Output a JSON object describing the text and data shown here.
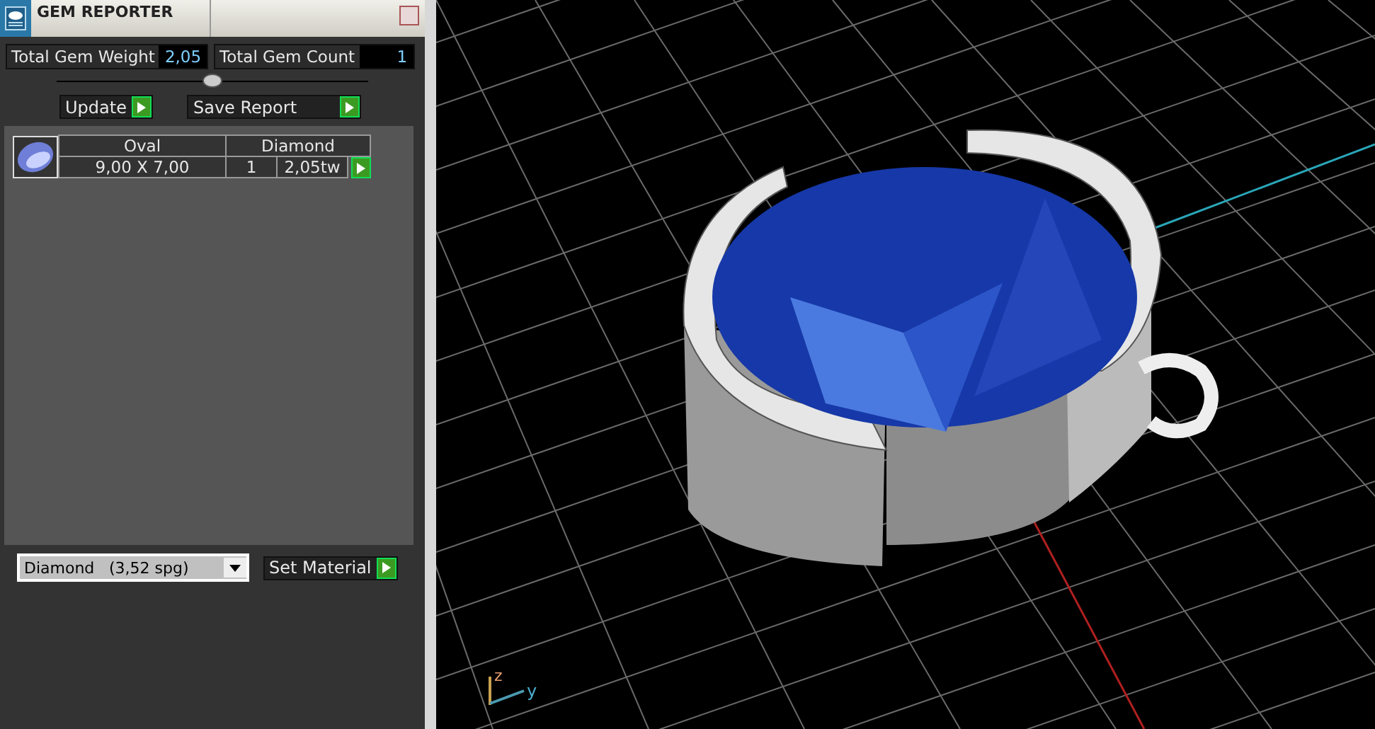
{
  "panel": {
    "title": "GEM REPORTER"
  },
  "totals": [
    {
      "label": "Total Gem Weight",
      "value": "2,05"
    },
    {
      "label": "Total Gem Count",
      "value": "1"
    }
  ],
  "buttons": [
    {
      "label": "Update"
    },
    {
      "label": "Save Report"
    }
  ],
  "gems": [
    {
      "shape": "Oval",
      "material": "Diamond",
      "size": "9,00 X 7,00",
      "count": "1",
      "weight": "2,05tw"
    }
  ],
  "material_select": {
    "name": "Diamond",
    "density": "(3,52 spg)"
  },
  "set_material": {
    "label": "Set Material"
  },
  "viewport": {
    "axes": [
      {
        "label": "z"
      },
      {
        "label": "y"
      }
    ]
  }
}
